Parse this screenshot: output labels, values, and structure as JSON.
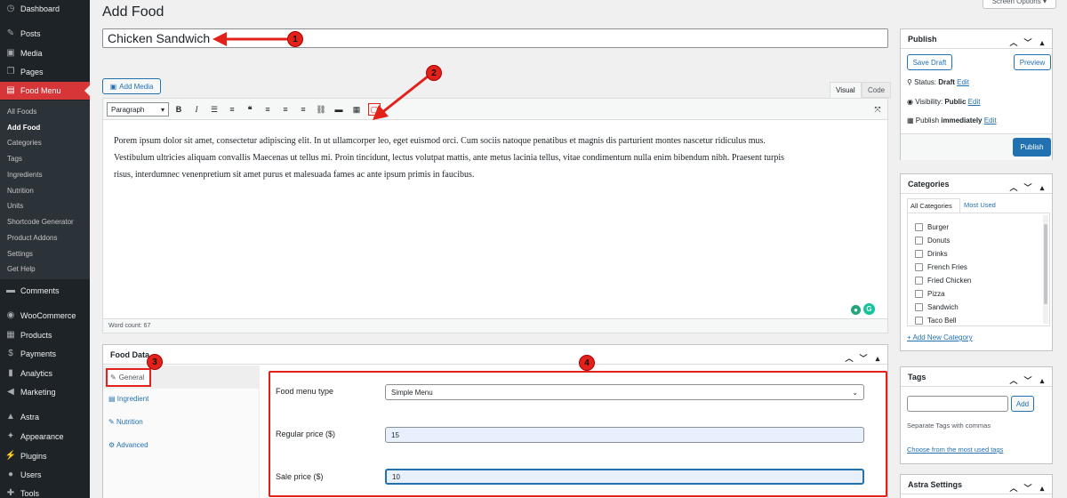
{
  "sidebar": {
    "dashboard": "Dashboard",
    "posts": "Posts",
    "media": "Media",
    "pages": "Pages",
    "food_menu": "Food Menu",
    "sub": [
      "All Foods",
      "Add Food",
      "Categories",
      "Tags",
      "Ingredients",
      "Nutrition",
      "Units",
      "Shortcode Generator",
      "Product Addons",
      "Settings",
      "Get Help"
    ],
    "comments": "Comments",
    "woocommerce": "WooCommerce",
    "products": "Products",
    "payments": "Payments",
    "analytics": "Analytics",
    "marketing": "Marketing",
    "astra": "Astra",
    "appearance": "Appearance",
    "plugins": "Plugins",
    "users": "Users",
    "tools": "Tools"
  },
  "page": {
    "title": "Add Food",
    "screen_options": "Screen Options ▾"
  },
  "post_title": "Chicken Sandwich",
  "editor": {
    "add_media": "Add Media",
    "tab_visual": "Visual",
    "tab_code": "Code",
    "format": "Paragraph",
    "body_line1": "Porem ipsum dolor sit amet, consectetur adipiscing elit. In ut ullamcorper leo, eget euismod orci. Cum sociis natoque penatibus et magnis dis parturient montes nascetur ridiculus mus.",
    "body_line2": "Vestibulum ultricies aliquam convallis Maecenas ut tellus mi. Proin tincidunt, lectus volutpat mattis, ante metus lacinia tellus, vitae condimentum nulla enim bibendum nibh. Praesent turpis",
    "body_line3": "risus, interdumnec venenpretium sit amet purus et malesuada fames ac ante ipsum primis in faucibus.",
    "word_count": "Word count: 67"
  },
  "food_data": {
    "title": "Food Data",
    "tabs": [
      "General",
      "Ingredient",
      "Nutrition",
      "Advanced"
    ],
    "menu_type_label": "Food menu type",
    "menu_type_value": "Simple Menu",
    "regular_price_label": "Regular price ($)",
    "regular_price_value": "15",
    "sale_price_label": "Sale price ($)",
    "sale_price_value": "10"
  },
  "publish": {
    "title": "Publish",
    "save_draft": "Save Draft",
    "preview": "Preview",
    "status_label": "Status:",
    "status_value": "Draft",
    "visibility_label": "Visibility:",
    "visibility_value": "Public",
    "publish_label": "Publish",
    "publish_value": "immediately",
    "edit": "Edit",
    "publish_button": "Publish"
  },
  "categories": {
    "title": "Categories",
    "tab_all": "All Categories",
    "tab_most": "Most Used",
    "items": [
      "Burger",
      "Donuts",
      "Drinks",
      "French Fries",
      "Fried Chicken",
      "Pizza",
      "Sandwich",
      "Taco Bell"
    ],
    "add_new": "+ Add New Category"
  },
  "tags": {
    "title": "Tags",
    "add": "Add",
    "hint": "Separate Tags with commas",
    "choose": "Choose from the most used tags"
  },
  "astra": {
    "title": "Astra Settings"
  },
  "annotations": [
    "1",
    "2",
    "3",
    "4"
  ],
  "colors": {
    "accent": "#2271b1",
    "annotation": "#e3211b",
    "sidebar": "#1d2327",
    "active_menu": "#d63638"
  }
}
